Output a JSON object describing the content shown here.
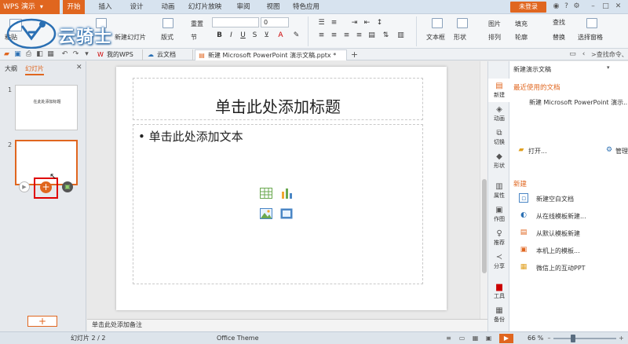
{
  "app": {
    "name": "WPS 演示"
  },
  "menu_tabs": [
    "开始",
    "插入",
    "设计",
    "动画",
    "幻灯片放映",
    "审阅",
    "视图",
    "特色应用"
  ],
  "login_label": "未登录",
  "watermark": "云骑士",
  "ribbon": {
    "paste": "粘贴",
    "new_slide": "新建幻灯片",
    "layout": "版式",
    "section": "节",
    "reset": "重置",
    "font_size": "0",
    "textbox": "文本框",
    "shape": "形状",
    "arrange": "排列",
    "picture": "图片",
    "fill": "填充",
    "outline": "轮廓",
    "find": "查找",
    "replace": "替换",
    "select_pane": "选择窗格"
  },
  "doc_tabs": [
    {
      "label": "我的WPS"
    },
    {
      "label": "云文档"
    },
    {
      "label": "新建 Microsoft PowerPoint 演示文稿.pptx *"
    }
  ],
  "search_placeholder": ">查找命令、搜索",
  "left_panel": {
    "tab_outline": "大纲",
    "tab_slides": "幻灯片",
    "slide1_num": "1",
    "slide1_text": "在此处添加标题",
    "slide2_num": "2"
  },
  "slide": {
    "title_placeholder": "单击此处添加标题",
    "body_bullet": "•",
    "body_placeholder": "单击此处添加文本"
  },
  "notes_placeholder": "单击此处添加备注",
  "side_strip": [
    "新建",
    "动画",
    "切换",
    "形状",
    "属性",
    "作图",
    "推荐",
    "分享",
    "工具",
    "备份"
  ],
  "task_pane": {
    "title": "新建演示文稿",
    "recent_header": "最近使用的文档",
    "recent_item": "新建 Microsoft PowerPoint 演示...",
    "open": "打开...",
    "manage": "管理",
    "new_header": "新建",
    "new_items": [
      "新建空白文档",
      "从在线模板新建...",
      "从默认模板新建",
      "本机上的模板...",
      "微信上的互动PPT"
    ]
  },
  "status": {
    "slide_counter": "幻灯片 2 / 2",
    "theme": "Office Theme",
    "zoom": "66 %",
    "zoom_level": 0.66
  },
  "colors": {
    "accent": "#e0661f"
  }
}
